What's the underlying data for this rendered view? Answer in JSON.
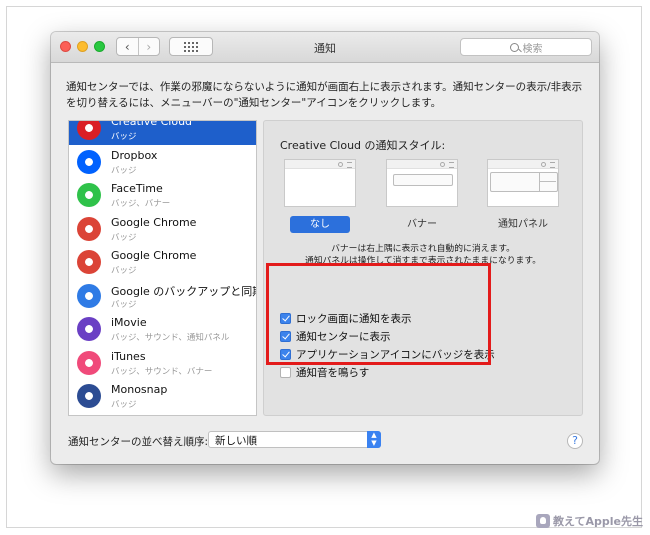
{
  "window": {
    "title": "通知",
    "search_placeholder": "検索"
  },
  "description": "通知センターでは、作業の邪魔にならないように通知が画面右上に表示されます。通知センターの表示/非表示を切り替えるには、メニューバーの\"通知センター\"アイコンをクリックします。",
  "apps": [
    {
      "name": "Creative Cloud",
      "sub": "バッジ",
      "icon": "creative-cloud-icon",
      "color": "#da1f26",
      "selected": true
    },
    {
      "name": "Dropbox",
      "sub": "バッジ",
      "icon": "dropbox-icon",
      "color": "#0061fe"
    },
    {
      "name": "FaceTime",
      "sub": "バッジ、バナー",
      "icon": "facetime-icon",
      "color": "#2fc24a"
    },
    {
      "name": "Google Chrome",
      "sub": "バッジ",
      "icon": "chrome-icon",
      "color": "#db4437"
    },
    {
      "name": "Google Chrome",
      "sub": "バッジ",
      "icon": "chrome-icon",
      "color": "#db4437"
    },
    {
      "name": "Google のバックアップと同期",
      "sub": "バッジ",
      "icon": "backup-sync-icon",
      "color": "#2f7be5"
    },
    {
      "name": "iMovie",
      "sub": "バッジ、サウンド、通知パネル",
      "icon": "imovie-icon",
      "color": "#6a3fc4"
    },
    {
      "name": "iTunes",
      "sub": "バッジ、サウンド、バナー",
      "icon": "itunes-icon",
      "color": "#f04a7a"
    },
    {
      "name": "Monosnap",
      "sub": "バッジ",
      "icon": "monosnap-icon",
      "color": "#2c4c93"
    }
  ],
  "style_panel": {
    "title": "Creative Cloud の通知スタイル:",
    "styles": [
      {
        "label": "なし",
        "selected": true
      },
      {
        "label": "バナー"
      },
      {
        "label": "通知パネル"
      }
    ],
    "note_line1": "バナーは右上隅に表示され自動的に消えます。",
    "note_line2": "通知パネルは操作して消すまで表示されたままになります。"
  },
  "options": [
    {
      "label": "ロック画面に通知を表示",
      "checked": true
    },
    {
      "label": "通知センターに表示",
      "checked": true
    },
    {
      "label": "アプリケーションアイコンにバッジを表示",
      "checked": true
    },
    {
      "label": "通知音を鳴らす",
      "checked": false
    }
  ],
  "sort": {
    "label": "通知センターの並べ替え順序:",
    "value": "新しい順"
  },
  "help_label": "?",
  "watermark": "教えてApple先生",
  "colors": {
    "accent": "#2c70dc",
    "highlight_box": "#e31b1b"
  }
}
